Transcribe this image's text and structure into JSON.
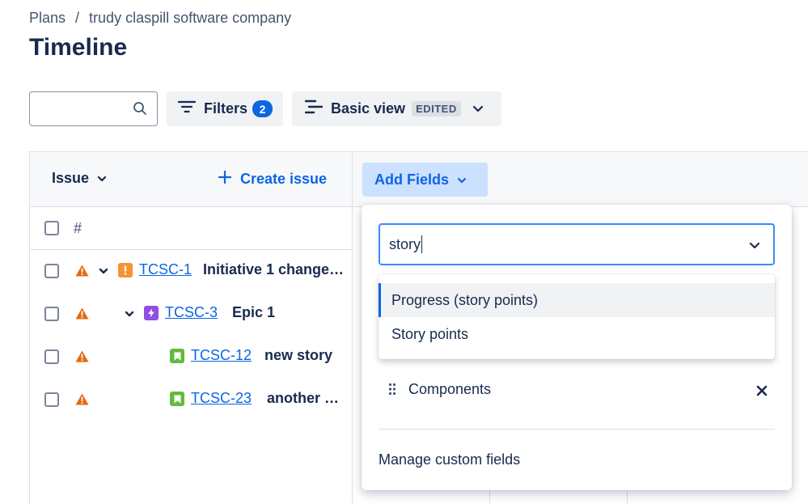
{
  "breadcrumb": {
    "parent": "Plans",
    "separator": "/",
    "current": "trudy claspill software company"
  },
  "page_title": "Timeline",
  "search": {
    "value": "",
    "placeholder": ""
  },
  "filters": {
    "label": "Filters",
    "count": "2"
  },
  "view": {
    "label": "Basic view",
    "lozenge": "EDITED"
  },
  "table": {
    "issue_header": "Issue",
    "create_issue": "Create issue",
    "add_fields": "Add Fields",
    "number_col": "#",
    "rows": [
      {
        "key": "TCSC-1",
        "summary": "Initiative 1 change…",
        "type": "initiative",
        "level": 0
      },
      {
        "key": "TCSC-3",
        "summary": "Epic 1",
        "type": "epic",
        "level": 1
      },
      {
        "key": "TCSC-12",
        "summary": "new story",
        "type": "story",
        "level": 2
      },
      {
        "key": "TCSC-23",
        "summary": "another …",
        "type": "story",
        "level": 2
      }
    ]
  },
  "popup": {
    "search_value": "story",
    "options": [
      "Progress (story points)",
      "Story points"
    ],
    "selected_index": 0,
    "fields": [
      "Components"
    ],
    "manage_label": "Manage custom fields"
  },
  "colors": {
    "accent": "#0c66e4",
    "warning": "#e56910",
    "initiative": "#f79232",
    "epic": "#904ee2",
    "story": "#63ba3c"
  }
}
